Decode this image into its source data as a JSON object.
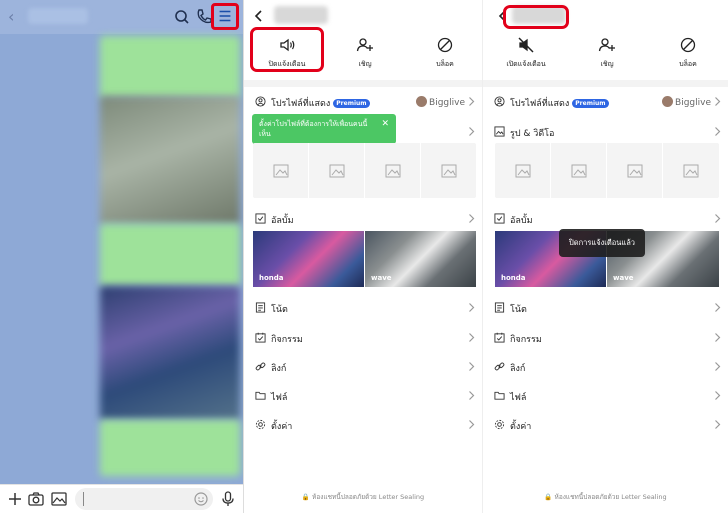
{
  "chat": {
    "input_placeholder": ""
  },
  "profile_before": {
    "actions": [
      {
        "label": "ปิดแจ้งเตือน",
        "icon": "speaker-icon"
      },
      {
        "label": "เชิญ",
        "icon": "add-person-icon"
      },
      {
        "label": "บล็อค",
        "icon": "block-icon"
      }
    ],
    "profile_label": "โปรไฟล์ที่แสดง",
    "premium_badge": "Premium",
    "profile_value": "Bigglive",
    "toast_text": "ตั้งค่าโปรไฟล์ที่ต้องการให้เพื่อนคนนี้เห็น",
    "toast_close": "✕",
    "album_label": "อัลบั้ม",
    "album_captions": [
      "honda",
      "wave"
    ],
    "menu": [
      "โน้ต",
      "กิจกรรม",
      "ลิงก์",
      "ไฟล์",
      "ตั้งค่า"
    ],
    "footer": "ห้องแชทนี้ปลอดภัยด้วย Letter Sealing"
  },
  "profile_after": {
    "actions": [
      {
        "label": "เปิดแจ้งเตือน",
        "icon": "muted-speaker-icon"
      },
      {
        "label": "เชิญ",
        "icon": "add-person-icon"
      },
      {
        "label": "บล็อค",
        "icon": "block-icon"
      }
    ],
    "profile_label": "โปรไฟล์ที่แสดง",
    "premium_badge": "Premium",
    "profile_value": "Bigglive",
    "media_label": "รูป & วิดีโอ",
    "album_label": "อัลบั้ม",
    "album_captions": [
      "honda",
      "wave"
    ],
    "toast_text": "ปิดการแจ้งเตือนแล้ว",
    "menu": [
      "โน้ต",
      "กิจกรรม",
      "ลิงก์",
      "ไฟล์",
      "ตั้งค่า"
    ],
    "footer": "ห้องแชทนี้ปลอดภัยด้วย Letter Sealing"
  },
  "colors": {
    "highlight": "#e2001a",
    "premium": "#2e66e3",
    "toast_green": "#4cc764",
    "chat_bg": "#8ea9d6",
    "bubble_green": "#9ee29a"
  }
}
